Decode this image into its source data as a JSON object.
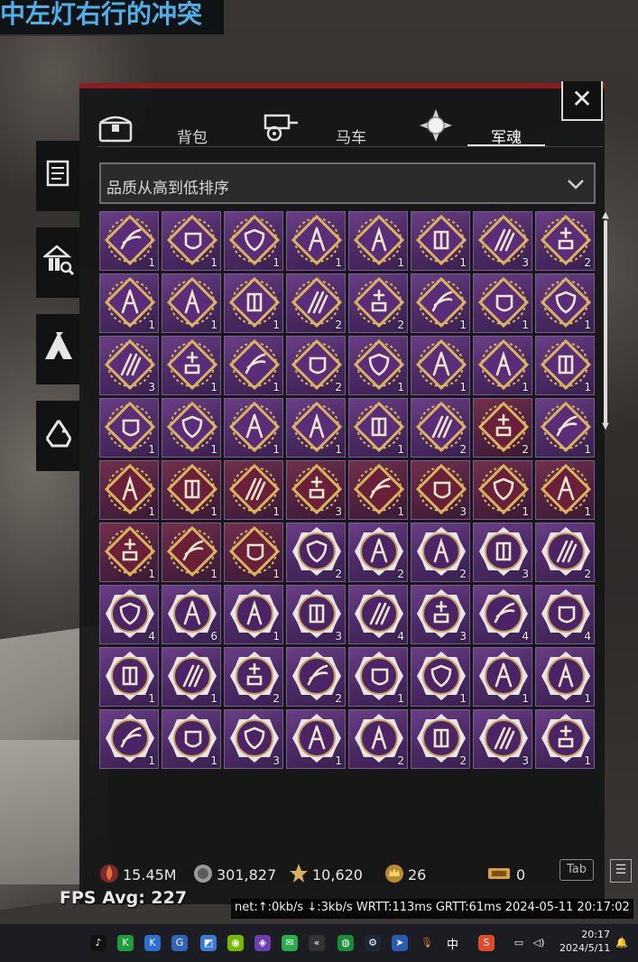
{
  "banner": {
    "text": "中左灯右行的冲突"
  },
  "side_tabs": [
    {
      "name": "scroll"
    },
    {
      "name": "warehouse-search"
    },
    {
      "name": "tent"
    },
    {
      "name": "recycle"
    }
  ],
  "close_label": "✕",
  "tabs": [
    {
      "label": "背包",
      "icon": "chest-icon",
      "active": false
    },
    {
      "label": "马车",
      "icon": "cart-icon",
      "active": false
    },
    {
      "label": "军魂",
      "icon": "soul-orb-icon",
      "active": true
    }
  ],
  "sort": {
    "selected": "品质从高到低排序"
  },
  "grid": {
    "rows": [
      [
        [
          "gold",
          "red-purple",
          "1"
        ],
        [
          "gold",
          "purple",
          "1"
        ],
        [
          "gold",
          "purple",
          "1"
        ],
        [
          "gold",
          "purple",
          "1"
        ],
        [
          "gold",
          "purple",
          "1"
        ],
        [
          "gold",
          "purple",
          "1"
        ],
        [
          "gold",
          "purple",
          "3"
        ],
        [
          "gold",
          "purple",
          "2"
        ]
      ],
      [
        [
          "gold",
          "purple",
          "1"
        ],
        [
          "gold",
          "purple",
          "1"
        ],
        [
          "gold",
          "purple",
          "1"
        ],
        [
          "gold",
          "purple",
          "2"
        ],
        [
          "gold",
          "purple",
          "2"
        ],
        [
          "gold",
          "purple",
          "1"
        ],
        [
          "gold",
          "purple",
          "1"
        ],
        [
          "gold",
          "purple",
          "1"
        ]
      ],
      [
        [
          "gold",
          "purple",
          "3"
        ],
        [
          "gold",
          "purple",
          "1"
        ],
        [
          "gold",
          "purple",
          "1"
        ],
        [
          "gold",
          "purple",
          "2"
        ],
        [
          "gold",
          "purple",
          "1"
        ],
        [
          "gold",
          "purple",
          "1"
        ],
        [
          "gold",
          "purple",
          "1"
        ],
        [
          "gold",
          "purple",
          "1"
        ]
      ],
      [
        [
          "gold",
          "purple",
          "1"
        ],
        [
          "gold",
          "purple",
          "1"
        ],
        [
          "gold",
          "purple",
          "1"
        ],
        [
          "gold",
          "purple",
          "1"
        ],
        [
          "gold",
          "purple",
          "1"
        ],
        [
          "gold",
          "purple",
          "2"
        ],
        [
          "gold",
          "red",
          "2"
        ],
        [
          "gold",
          "purple",
          "1"
        ]
      ],
      [
        [
          "gold",
          "red",
          "1"
        ],
        [
          "gold",
          "red",
          "1"
        ],
        [
          "gold",
          "red",
          "1"
        ],
        [
          "gold",
          "red",
          "3"
        ],
        [
          "gold",
          "red",
          "1"
        ],
        [
          "gold",
          "red",
          "3"
        ],
        [
          "gold",
          "red",
          "1"
        ],
        [
          "gold",
          "red",
          "1"
        ]
      ],
      [
        [
          "gold",
          "red",
          "1"
        ],
        [
          "gold",
          "red",
          "1"
        ],
        [
          "gold",
          "red",
          "1"
        ],
        [
          "silver",
          "purple",
          "2"
        ],
        [
          "silver",
          "purple",
          "2"
        ],
        [
          "silver",
          "purple",
          "2"
        ],
        [
          "silver",
          "purple",
          "3"
        ],
        [
          "silver",
          "purple",
          "2"
        ]
      ],
      [
        [
          "silver",
          "purple",
          "4"
        ],
        [
          "silver",
          "purple",
          "6"
        ],
        [
          "silver",
          "purple",
          "1"
        ],
        [
          "silver",
          "purple",
          "3"
        ],
        [
          "silver",
          "purple",
          "4"
        ],
        [
          "silver",
          "purple",
          "3"
        ],
        [
          "silver",
          "purple",
          "4"
        ],
        [
          "silver",
          "purple",
          "4"
        ]
      ],
      [
        [
          "silver",
          "purple",
          "1"
        ],
        [
          "silver",
          "purple",
          "1"
        ],
        [
          "silver",
          "purple",
          "2"
        ],
        [
          "silver",
          "purple",
          "2"
        ],
        [
          "silver",
          "purple",
          "1"
        ],
        [
          "silver",
          "purple",
          "1"
        ],
        [
          "silver",
          "purple",
          "1"
        ],
        [
          "silver",
          "purple",
          "1"
        ]
      ],
      [
        [
          "silver",
          "purple",
          "1"
        ],
        [
          "silver",
          "purple",
          "1"
        ],
        [
          "silver",
          "purple",
          "3"
        ],
        [
          "silver",
          "purple",
          "1"
        ],
        [
          "silver",
          "purple",
          "2"
        ],
        [
          "silver",
          "purple",
          "2"
        ],
        [
          "silver",
          "purple",
          "3"
        ],
        [
          "silver",
          "purple",
          "1"
        ]
      ]
    ]
  },
  "currencies": [
    {
      "icon": "flame-coin-icon",
      "value": "15.45M"
    },
    {
      "icon": "silver-coin-icon",
      "value": "301,827"
    },
    {
      "icon": "honor-medal-icon",
      "value": "10,620"
    },
    {
      "icon": "crown-coin-icon",
      "value": "26"
    },
    {
      "icon": "ticket-icon",
      "value": "0"
    }
  ],
  "tab_key": "Tab",
  "fps": "FPS Avg: 227",
  "net": "net:↑:0kb/s ↓:3kb/s WRTT:113ms GRTT:61ms 2024-05-11 20:17:02",
  "taskbar": {
    "lang": "中",
    "time": "20:17",
    "date": "2024/5/11"
  },
  "colors": {
    "panel_border": "#8a1d1d",
    "gold_frame": "#d9b45a",
    "silver_frame": "#d8d6dc",
    "banner_text": "#4fb0e8"
  }
}
